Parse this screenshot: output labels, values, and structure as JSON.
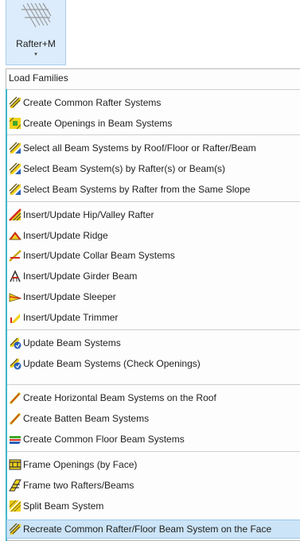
{
  "ribbon": {
    "button_label": "Rafter+M",
    "dropdown_arrow": "▾"
  },
  "menu": {
    "header_item": "Load Families",
    "items": [
      {
        "label": "Create Common Rafter Systems",
        "icon": "rafter-system-icon"
      },
      {
        "label": "Create Openings in Beam Systems",
        "icon": "openings-icon"
      },
      {
        "label": "Select all Beam Systems by Roof/Floor or Rafter/Beam",
        "icon": "select-systems-icon"
      },
      {
        "label": "Select Beam System(s) by Rafter(s) or Beam(s)",
        "icon": "select-systems-icon"
      },
      {
        "label": "Select Beam Systems by Rafter from the Same Slope",
        "icon": "select-systems-icon"
      },
      {
        "label": "Insert/Update Hip/Valley Rafter",
        "icon": "hip-valley-icon"
      },
      {
        "label": "Insert/Update Ridge",
        "icon": "ridge-icon"
      },
      {
        "label": "Insert/Update Collar Beam Systems",
        "icon": "collar-beam-icon"
      },
      {
        "label": "Insert/Update Girder Beam",
        "icon": "girder-beam-icon"
      },
      {
        "label": "Insert/Update Sleeper",
        "icon": "sleeper-icon"
      },
      {
        "label": "Insert/Update Trimmer",
        "icon": "trimmer-icon"
      },
      {
        "label": "Update Beam Systems",
        "icon": "update-systems-icon"
      },
      {
        "label": "Update Beam Systems (Check Openings)",
        "icon": "update-systems-icon"
      },
      {
        "label": "Create Horizontal Beam Systems on the Roof",
        "icon": "horizontal-beam-icon"
      },
      {
        "label": "Create Batten Beam Systems",
        "icon": "batten-icon"
      },
      {
        "label": "Create Common Floor Beam Systems",
        "icon": "floor-beam-icon"
      },
      {
        "label": "Frame Openings (by Face)",
        "icon": "frame-openings-icon"
      },
      {
        "label": "Frame two Rafters/Beams",
        "icon": "frame-rafters-icon"
      },
      {
        "label": "Split Beam System",
        "icon": "split-system-icon"
      },
      {
        "label": "Recreate Common Rafter/Floor Beam System on the Face",
        "icon": "recreate-system-icon"
      }
    ]
  },
  "colors": {
    "accent_bar": "#3fb6c9",
    "icon_yellow": "#f2d21b",
    "icon_green": "#43a62a",
    "icon_red": "#d42a1e",
    "icon_blue": "#2b5fb8",
    "highlight": "#cce4f7"
  }
}
